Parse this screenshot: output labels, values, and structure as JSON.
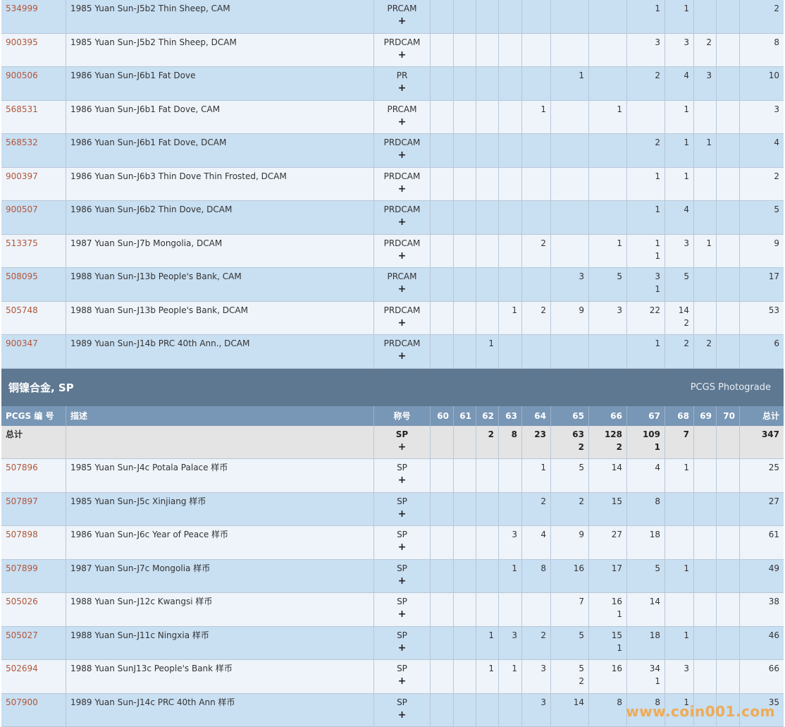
{
  "top_rows": [
    {
      "code": "534999",
      "desc": "1985 Yuan Sun-J5b2 Thin Sheep, CAM",
      "designation": "PRCAM",
      "g60": "",
      "g61": "",
      "g62": "",
      "g63": "",
      "g64": "",
      "g65": "",
      "g66": "",
      "g67": "1",
      "g68": "1",
      "g69": "",
      "g70": "",
      "total": "2",
      "g67b": ""
    },
    {
      "code": "900395",
      "desc": "1985 Yuan Sun-J5b2 Thin Sheep, DCAM",
      "designation": "PRDCAM",
      "g60": "",
      "g61": "",
      "g62": "",
      "g63": "",
      "g64": "",
      "g65": "",
      "g66": "",
      "g67": "3",
      "g68": "3",
      "g69": "2",
      "g70": "",
      "total": "8"
    },
    {
      "code": "900506",
      "desc": "1986 Yuan Sun-J6b1 Fat Dove",
      "designation": "PR",
      "g60": "",
      "g61": "",
      "g62": "",
      "g63": "",
      "g64": "",
      "g65": "1",
      "g66": "",
      "g67": "2",
      "g68": "4",
      "g69": "3",
      "g70": "",
      "total": "10"
    },
    {
      "code": "568531",
      "desc": "1986 Yuan Sun-J6b1 Fat Dove, CAM",
      "designation": "PRCAM",
      "g60": "",
      "g61": "",
      "g62": "",
      "g63": "",
      "g64": "1",
      "g65": "",
      "g66": "1",
      "g67": "",
      "g68": "1",
      "g69": "",
      "g70": "",
      "total": "3"
    },
    {
      "code": "568532",
      "desc": "1986 Yuan Sun-J6b1 Fat Dove, DCAM",
      "designation": "PRDCAM",
      "g60": "",
      "g61": "",
      "g62": "",
      "g63": "",
      "g64": "",
      "g65": "",
      "g66": "",
      "g67": "2",
      "g68": "1",
      "g69": "1",
      "g70": "",
      "total": "4"
    },
    {
      "code": "900397",
      "desc": "1986 Yuan Sun-J6b3 Thin Dove Thin Frosted, DCAM",
      "designation": "PRDCAM",
      "g60": "",
      "g61": "",
      "g62": "",
      "g63": "",
      "g64": "",
      "g65": "",
      "g66": "",
      "g67": "1",
      "g68": "1",
      "g69": "",
      "g70": "",
      "total": "2"
    },
    {
      "code": "900507",
      "desc": "1986 Yuan Sun-J6b2 Thin Dove, DCAM",
      "designation": "PRDCAM",
      "g60": "",
      "g61": "",
      "g62": "",
      "g63": "",
      "g64": "",
      "g65": "",
      "g66": "",
      "g67": "1",
      "g68": "4",
      "g69": "",
      "g70": "",
      "total": "5"
    },
    {
      "code": "513375",
      "desc": "1987 Yuan Sun-J7b Mongolia, DCAM",
      "designation": "PRDCAM",
      "g60": "",
      "g61": "",
      "g62": "",
      "g63": "",
      "g64": "2",
      "g65": "",
      "g66": "1",
      "g67": "1",
      "g67b": "1",
      "g68": "3",
      "g69": "1",
      "g70": "",
      "total": "9"
    },
    {
      "code": "508095",
      "desc": "1988 Yuan Sun-J13b People's Bank, CAM",
      "designation": "PRCAM",
      "g60": "",
      "g61": "",
      "g62": "",
      "g63": "",
      "g64": "",
      "g65": "3",
      "g66": "5",
      "g67": "3",
      "g67b": "1",
      "g68": "5",
      "g69": "",
      "g70": "",
      "total": "17"
    },
    {
      "code": "505748",
      "desc": "1988 Yuan Sun-J13b People's Bank, DCAM",
      "designation": "PRDCAM",
      "g60": "",
      "g61": "",
      "g62": "",
      "g63": "1",
      "g64": "2",
      "g65": "9",
      "g66": "3",
      "g67": "22",
      "g68": "14",
      "g68b": "2",
      "g69": "",
      "g70": "",
      "total": "53"
    },
    {
      "code": "900347",
      "desc": "1989 Yuan Sun-J14b PRC 40th Ann., DCAM",
      "designation": "PRDCAM",
      "g60": "",
      "g61": "",
      "g62": "1",
      "g63": "",
      "g64": "",
      "g65": "",
      "g66": "",
      "g67": "1",
      "g68": "2",
      "g69": "2",
      "g70": "",
      "total": "6"
    }
  ],
  "section": {
    "title": "铜镍合金, SP",
    "photograde": "PCGS Photograde"
  },
  "headers": {
    "code": "PCGS 编 号",
    "desc": "描述",
    "designation": "称号",
    "g60": "60",
    "g61": "61",
    "g62": "62",
    "g63": "63",
    "g64": "64",
    "g65": "65",
    "g66": "66",
    "g67": "67",
    "g68": "68",
    "g69": "69",
    "g70": "70",
    "total": "总计"
  },
  "total_row": {
    "label": "总计",
    "designation": "SP",
    "g62": "2",
    "g63": "8",
    "g64": "23",
    "g65": "63",
    "g65b": "2",
    "g66": "128",
    "g66b": "2",
    "g67": "109",
    "g67b": "1",
    "g68": "7",
    "total": "347"
  },
  "sp_rows": [
    {
      "code": "507896",
      "desc": "1985 Yuan Sun-J4c Potala Palace 样币",
      "designation": "SP",
      "g64": "1",
      "g65": "5",
      "g66": "14",
      "g67": "4",
      "g68": "1",
      "total": "25"
    },
    {
      "code": "507897",
      "desc": "1985 Yuan Sun-J5c Xinjiang 样币",
      "designation": "SP",
      "g64": "2",
      "g65": "2",
      "g66": "15",
      "g67": "8",
      "total": "27"
    },
    {
      "code": "507898",
      "desc": "1986 Yuan Sun-J6c Year of Peace 样币",
      "designation": "SP",
      "g63": "3",
      "g64": "4",
      "g65": "9",
      "g66": "27",
      "g67": "18",
      "total": "61"
    },
    {
      "code": "507899",
      "desc": "1987 Yuan Sun-J7c Mongolia 样币",
      "designation": "SP",
      "g63": "1",
      "g64": "8",
      "g65": "16",
      "g66": "17",
      "g67": "5",
      "g68": "1",
      "total": "49"
    },
    {
      "code": "505026",
      "desc": "1988 Yuan Sun-J12c Kwangsi 样币",
      "designation": "SP",
      "g65": "7",
      "g66": "16",
      "g66b": "1",
      "g67": "14",
      "total": "38"
    },
    {
      "code": "505027",
      "desc": "1988 Yuan Sun-J11c Ningxia 样币",
      "designation": "SP",
      "g62": "1",
      "g63": "3",
      "g64": "2",
      "g65": "5",
      "g66": "15",
      "g66b": "1",
      "g67": "18",
      "g68": "1",
      "total": "46"
    },
    {
      "code": "502694",
      "desc": "1988 Yuan SunJ13c People's Bank 样币",
      "designation": "SP",
      "g62": "1",
      "g63": "1",
      "g64": "3",
      "g65": "5",
      "g65b": "2",
      "g66": "16",
      "g67": "34",
      "g67b": "1",
      "g68": "3",
      "total": "66"
    },
    {
      "code": "507900",
      "desc": "1989 Yuan Sun-J14c PRC 40th Ann 样币",
      "designation": "SP",
      "g64": "3",
      "g65": "14",
      "g66": "8",
      "g67": "8",
      "g68": "1",
      "total": "35"
    }
  ],
  "plus_label": "+",
  "watermark": "www.coin001.com"
}
